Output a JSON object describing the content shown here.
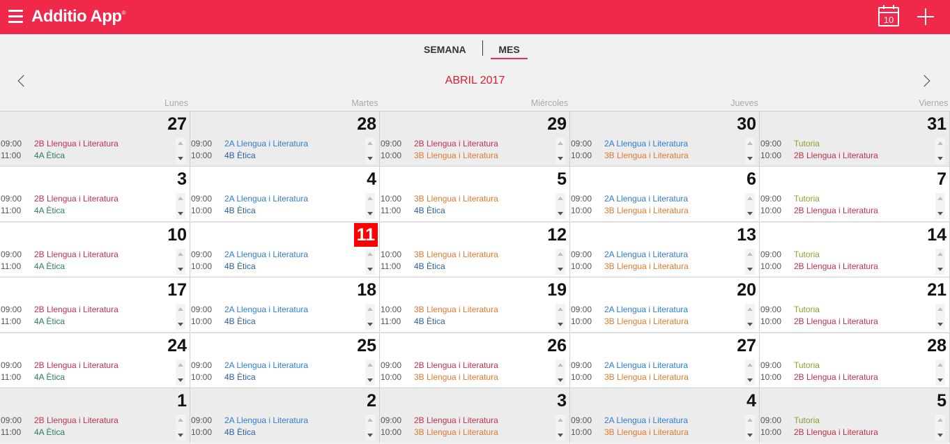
{
  "app": {
    "title": "Additio App",
    "trademark": "®",
    "calendar_icon_day": "10"
  },
  "tabs": {
    "week": "SEMANA",
    "month": "MES"
  },
  "month_title": "ABRIL 2017",
  "day_headers": [
    "Lunes",
    "Martes",
    "Miércoles",
    "Jueves",
    "Viernes"
  ],
  "colors": {
    "accent": "#f0284a",
    "today": "#ff0000"
  },
  "weeks": [
    {
      "days": [
        {
          "num": "27",
          "other": true,
          "events": [
            {
              "time": "09:00",
              "subject": "2B Llengua i Literatura",
              "color": "red"
            },
            {
              "time": "11:00",
              "subject": "4A Ètica",
              "color": "green"
            }
          ]
        },
        {
          "num": "28",
          "other": true,
          "events": [
            {
              "time": "09:00",
              "subject": "2A Llengua i Literatura",
              "color": "blue"
            },
            {
              "time": "10:00",
              "subject": "4B Ètica",
              "color": "navy"
            }
          ]
        },
        {
          "num": "29",
          "other": true,
          "events": [
            {
              "time": "09:00",
              "subject": "2B Llengua i Literatura",
              "color": "red"
            },
            {
              "time": "10:00",
              "subject": "3B Llengua i Literatura",
              "color": "orange"
            }
          ]
        },
        {
          "num": "30",
          "other": true,
          "events": [
            {
              "time": "09:00",
              "subject": "2A Llengua i Literatura",
              "color": "blue"
            },
            {
              "time": "10:00",
              "subject": "3B Llengua i Literatura",
              "color": "orange"
            }
          ]
        },
        {
          "num": "31",
          "other": true,
          "events": [
            {
              "time": "09:00",
              "subject": "Tutoria",
              "color": "olive"
            },
            {
              "time": "10:00",
              "subject": "2B Llengua i Literatura",
              "color": "red"
            }
          ]
        }
      ]
    },
    {
      "days": [
        {
          "num": "3",
          "events": [
            {
              "time": "09:00",
              "subject": "2B Llengua i Literatura",
              "color": "red"
            },
            {
              "time": "11:00",
              "subject": "4A Ètica",
              "color": "green"
            }
          ]
        },
        {
          "num": "4",
          "events": [
            {
              "time": "09:00",
              "subject": "2A Llengua i Literatura",
              "color": "blue"
            },
            {
              "time": "10:00",
              "subject": "4B Ètica",
              "color": "navy"
            }
          ]
        },
        {
          "num": "5",
          "events": [
            {
              "time": "10:00",
              "subject": "3B Llengua i Literatura",
              "color": "orange"
            },
            {
              "time": "11:00",
              "subject": "4B Ètica",
              "color": "navy"
            }
          ]
        },
        {
          "num": "6",
          "events": [
            {
              "time": "09:00",
              "subject": "2A Llengua i Literatura",
              "color": "blue"
            },
            {
              "time": "10:00",
              "subject": "3B Llengua i Literatura",
              "color": "orange"
            }
          ]
        },
        {
          "num": "7",
          "events": [
            {
              "time": "09:00",
              "subject": "Tutoria",
              "color": "olive"
            },
            {
              "time": "10:00",
              "subject": "2B Llengua i Literatura",
              "color": "red"
            }
          ]
        }
      ]
    },
    {
      "days": [
        {
          "num": "10",
          "events": [
            {
              "time": "09:00",
              "subject": "2B Llengua i Literatura",
              "color": "red"
            },
            {
              "time": "11:00",
              "subject": "4A Ètica",
              "color": "green"
            }
          ]
        },
        {
          "num": "11",
          "today": true,
          "events": [
            {
              "time": "09:00",
              "subject": "2A Llengua i Literatura",
              "color": "blue"
            },
            {
              "time": "10:00",
              "subject": "4B Ètica",
              "color": "navy"
            }
          ]
        },
        {
          "num": "12",
          "events": [
            {
              "time": "10:00",
              "subject": "3B Llengua i Literatura",
              "color": "orange"
            },
            {
              "time": "11:00",
              "subject": "4B Ètica",
              "color": "navy"
            }
          ]
        },
        {
          "num": "13",
          "events": [
            {
              "time": "09:00",
              "subject": "2A Llengua i Literatura",
              "color": "blue"
            },
            {
              "time": "10:00",
              "subject": "3B Llengua i Literatura",
              "color": "orange"
            }
          ]
        },
        {
          "num": "14",
          "events": [
            {
              "time": "09:00",
              "subject": "Tutoria",
              "color": "olive"
            },
            {
              "time": "10:00",
              "subject": "2B Llengua i Literatura",
              "color": "red"
            }
          ]
        }
      ]
    },
    {
      "days": [
        {
          "num": "17",
          "events": [
            {
              "time": "09:00",
              "subject": "2B Llengua i Literatura",
              "color": "red"
            },
            {
              "time": "11:00",
              "subject": "4A Ètica",
              "color": "green"
            }
          ]
        },
        {
          "num": "18",
          "events": [
            {
              "time": "09:00",
              "subject": "2A Llengua i Literatura",
              "color": "blue"
            },
            {
              "time": "10:00",
              "subject": "4B Ètica",
              "color": "navy"
            }
          ]
        },
        {
          "num": "19",
          "events": [
            {
              "time": "10:00",
              "subject": "3B Llengua i Literatura",
              "color": "orange"
            },
            {
              "time": "11:00",
              "subject": "4B Ètica",
              "color": "navy"
            }
          ]
        },
        {
          "num": "20",
          "events": [
            {
              "time": "09:00",
              "subject": "2A Llengua i Literatura",
              "color": "blue"
            },
            {
              "time": "10:00",
              "subject": "3B Llengua i Literatura",
              "color": "orange"
            }
          ]
        },
        {
          "num": "21",
          "events": [
            {
              "time": "09:00",
              "subject": "Tutoria",
              "color": "olive"
            },
            {
              "time": "10:00",
              "subject": "2B Llengua i Literatura",
              "color": "red"
            }
          ]
        }
      ]
    },
    {
      "days": [
        {
          "num": "24",
          "events": [
            {
              "time": "09:00",
              "subject": "2B Llengua i Literatura",
              "color": "red"
            },
            {
              "time": "11:00",
              "subject": "4A Ètica",
              "color": "green"
            }
          ]
        },
        {
          "num": "25",
          "events": [
            {
              "time": "09:00",
              "subject": "2A Llengua i Literatura",
              "color": "blue"
            },
            {
              "time": "10:00",
              "subject": "4B Ètica",
              "color": "navy"
            }
          ]
        },
        {
          "num": "26",
          "events": [
            {
              "time": "09:00",
              "subject": "2B Llengua i Literatura",
              "color": "red"
            },
            {
              "time": "10:00",
              "subject": "3B Llengua i Literatura",
              "color": "orange"
            }
          ]
        },
        {
          "num": "27",
          "events": [
            {
              "time": "09:00",
              "subject": "2A Llengua i Literatura",
              "color": "blue"
            },
            {
              "time": "10:00",
              "subject": "3B Llengua i Literatura",
              "color": "orange"
            }
          ]
        },
        {
          "num": "28",
          "events": [
            {
              "time": "09:00",
              "subject": "Tutoria",
              "color": "olive"
            },
            {
              "time": "10:00",
              "subject": "2B Llengua i Literatura",
              "color": "red"
            }
          ]
        }
      ]
    },
    {
      "days": [
        {
          "num": "1",
          "other": true,
          "events": [
            {
              "time": "09:00",
              "subject": "2B Llengua i Literatura",
              "color": "red"
            },
            {
              "time": "11:00",
              "subject": "4A Ètica",
              "color": "green"
            }
          ]
        },
        {
          "num": "2",
          "other": true,
          "events": [
            {
              "time": "09:00",
              "subject": "2A Llengua i Literatura",
              "color": "blue"
            },
            {
              "time": "10:00",
              "subject": "4B Ètica",
              "color": "navy"
            }
          ]
        },
        {
          "num": "3",
          "other": true,
          "events": [
            {
              "time": "09:00",
              "subject": "2B Llengua i Literatura",
              "color": "red"
            },
            {
              "time": "10:00",
              "subject": "3B Llengua i Literatura",
              "color": "orange"
            }
          ]
        },
        {
          "num": "4",
          "other": true,
          "events": [
            {
              "time": "09:00",
              "subject": "2A Llengua i Literatura",
              "color": "blue"
            },
            {
              "time": "10:00",
              "subject": "3B Llengua i Literatura",
              "color": "orange"
            }
          ]
        },
        {
          "num": "5",
          "other": true,
          "events": [
            {
              "time": "09:00",
              "subject": "Tutoria",
              "color": "olive"
            },
            {
              "time": "10:00",
              "subject": "2B Llengua i Literatura",
              "color": "red"
            }
          ]
        }
      ]
    }
  ]
}
